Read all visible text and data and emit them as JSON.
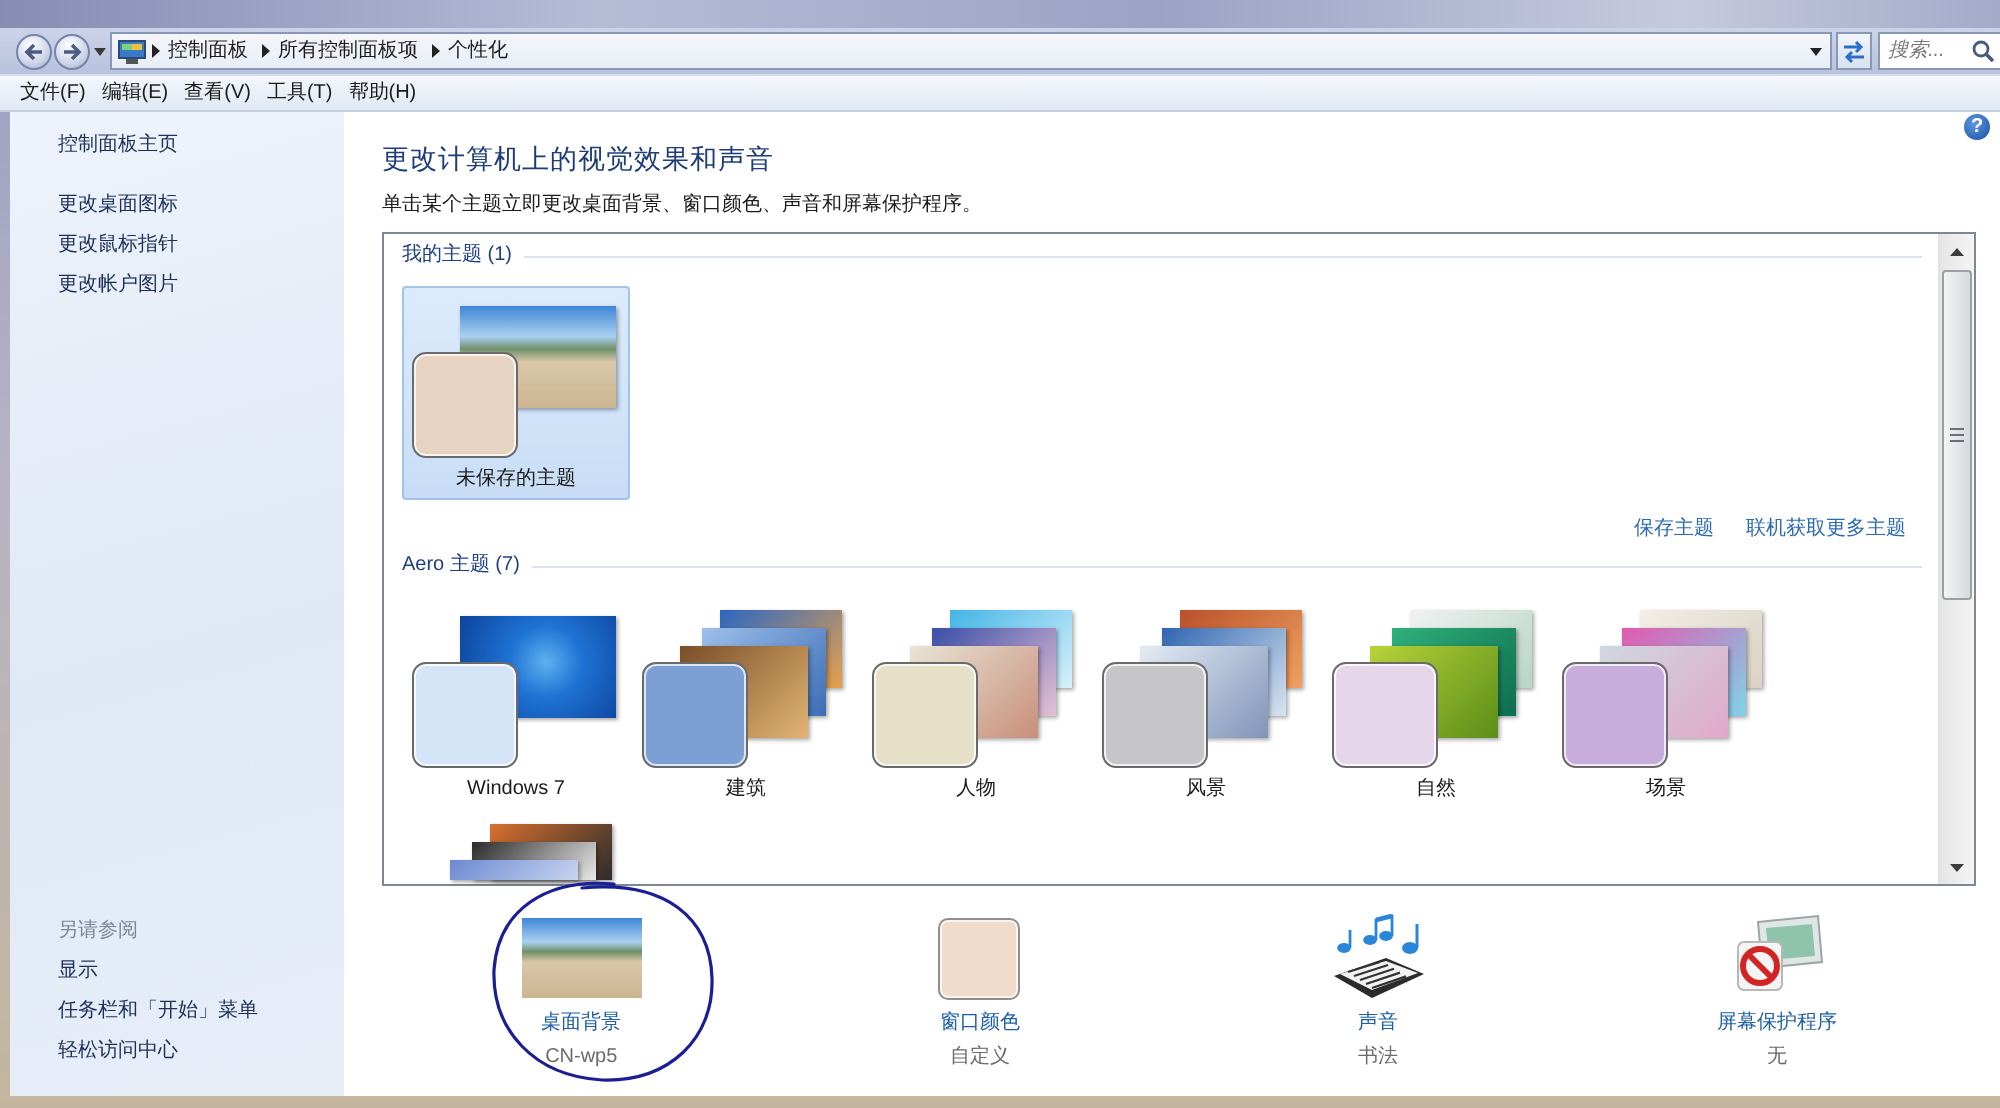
{
  "address_bar": {
    "crumbs": [
      "控制面板",
      "所有控制面板项",
      "个性化"
    ],
    "search": {
      "placeholder": "搜索..."
    }
  },
  "menu": [
    "文件(F)",
    "编辑(E)",
    "查看(V)",
    "工具(T)",
    "帮助(H)"
  ],
  "sidebar": {
    "home": "控制面板主页",
    "tasks": [
      "更改桌面图标",
      "更改鼠标指针",
      "更改帐户图片"
    ],
    "see_also": {
      "title": "另请参阅",
      "links": [
        "显示",
        "任务栏和「开始」菜单",
        "轻松访问中心"
      ]
    }
  },
  "help_button": {
    "label": "?"
  },
  "header": {
    "title": "更改计算机上的视觉效果和声音",
    "description": "单击某个主题立即更改桌面背景、窗口颜色、声音和屏幕保护程序。"
  },
  "themes": {
    "groups": [
      {
        "title": "我的主题 (1)",
        "items": [
          {
            "name": "未保存的主题",
            "kind": "single",
            "color": "#e7d3c1",
            "selected": true
          }
        ],
        "links": [
          "保存主题",
          "联机获取更多主题"
        ]
      },
      {
        "title": "Aero 主题 (7)",
        "items": [
          {
            "name": "Windows 7",
            "kind": "single",
            "color": "#d3e5f7",
            "selected": false
          },
          {
            "name": "建筑",
            "kind": "slideshow",
            "color": "#7da0d4",
            "selected": false
          },
          {
            "name": "人物",
            "kind": "slideshow",
            "color": "#e6e0c8",
            "selected": false
          },
          {
            "name": "风景",
            "kind": "slideshow",
            "color": "#c6c6c8",
            "selected": false
          },
          {
            "name": "自然",
            "kind": "slideshow",
            "color": "#e5d6e9",
            "selected": false
          },
          {
            "name": "场景",
            "kind": "slideshow",
            "color": "#c7acdc",
            "selected": false
          },
          {
            "kind": "slideshow",
            "selected": false
          }
        ]
      }
    ]
  },
  "settings": [
    {
      "kind": "wallpaper",
      "label": "桌面背景",
      "value": "CN-wp5"
    },
    {
      "kind": "color",
      "label": "窗口颜色",
      "value": "自定义",
      "color": "#efdccc"
    },
    {
      "kind": "sound",
      "label": "声音",
      "value": "书法"
    },
    {
      "kind": "screensaver",
      "label": "屏幕保护程序",
      "value": "无"
    }
  ]
}
